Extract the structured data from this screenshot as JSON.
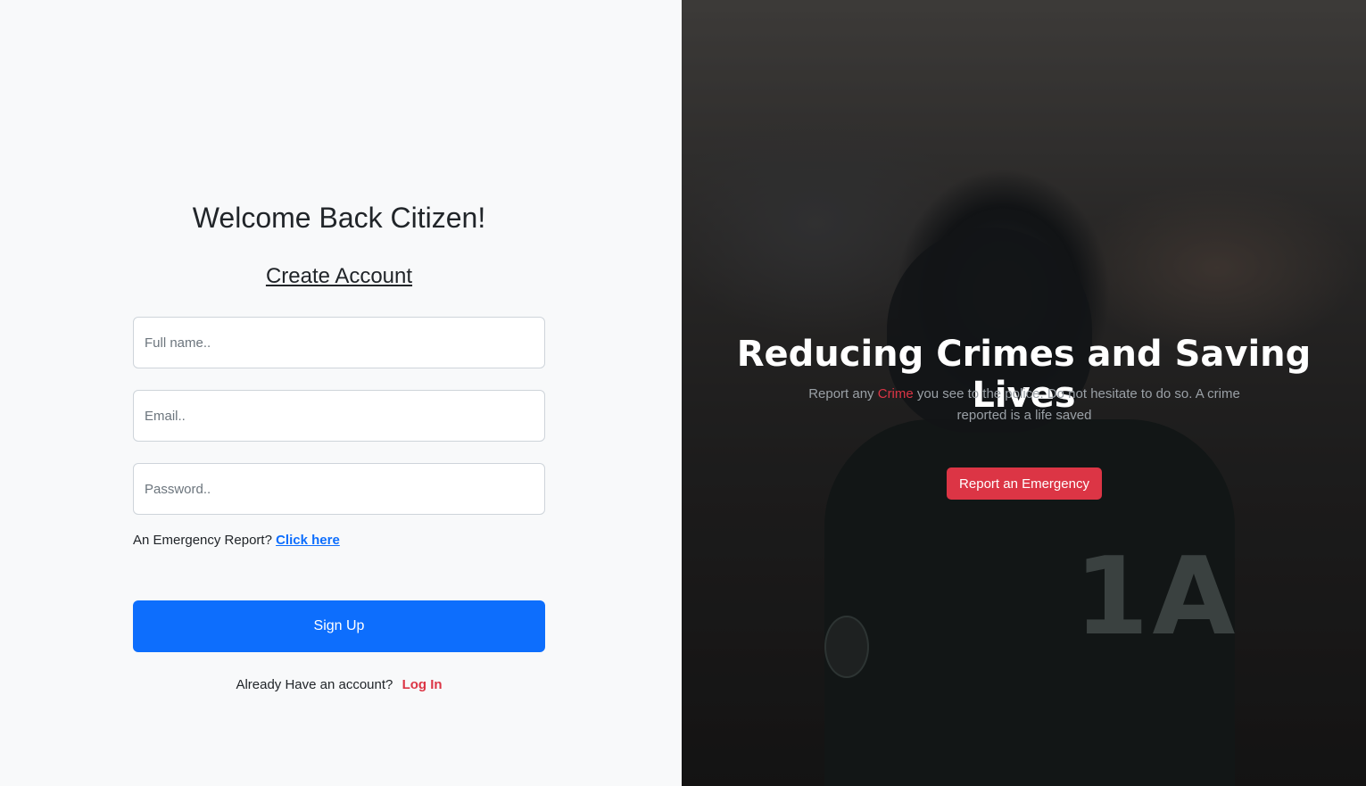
{
  "form": {
    "welcome": "Welcome Back Citizen!",
    "create_account": "Create Account",
    "fields": {
      "fullname_placeholder": "Full name..",
      "email_placeholder": "Email..",
      "password_placeholder": "Password.."
    },
    "emergency_prompt": "An Emergency Report?",
    "emergency_link": "Click here",
    "signup_label": "Sign Up",
    "login_prompt": "Already Have an account?",
    "login_link": "Log In"
  },
  "hero": {
    "title": "Reducing Crimes and Saving Lives",
    "subtitle_before": "Report any ",
    "subtitle_highlight": "Crime",
    "subtitle_after": " you see to the police. Do not hesitate to do so. A crime reported is a life saved",
    "report_button": "Report an Emergency",
    "armor_text": "1A"
  },
  "colors": {
    "primary": "#0d6efd",
    "danger": "#dc3545",
    "background": "#f8f9fa"
  }
}
